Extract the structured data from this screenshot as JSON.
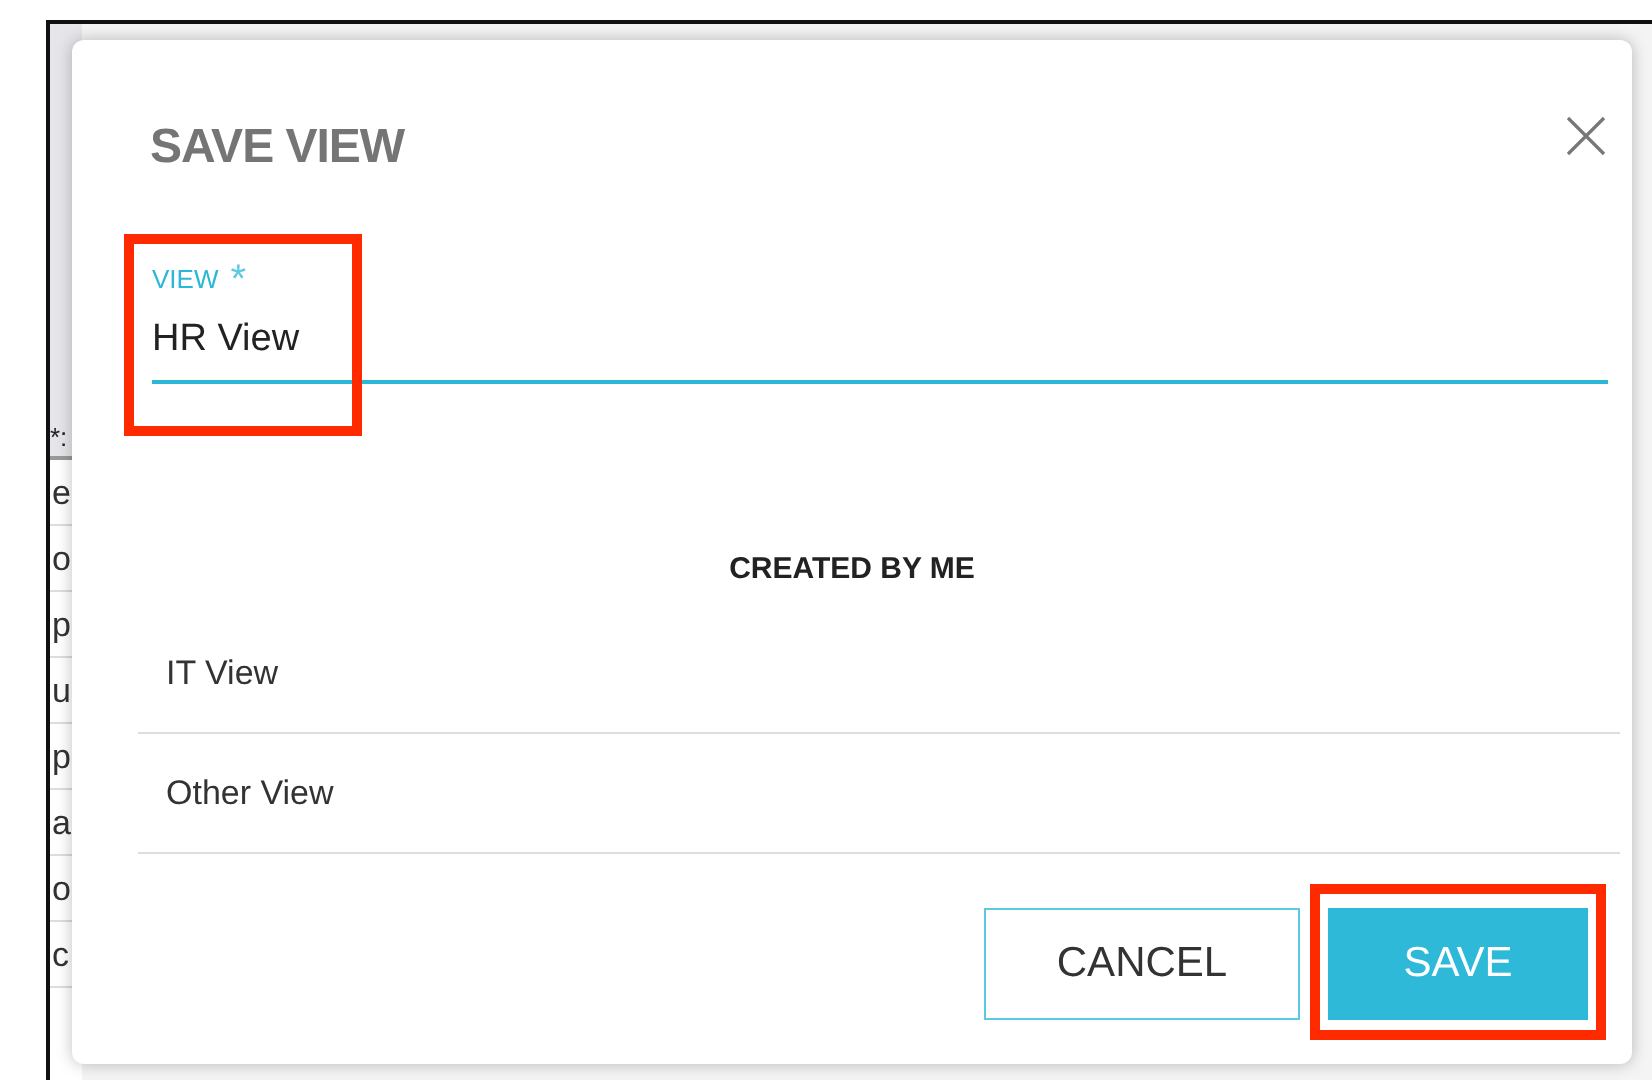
{
  "background_table": {
    "header": "*:",
    "cells": [
      "e",
      "o",
      "p",
      "u",
      "p",
      "a",
      "o",
      "c"
    ]
  },
  "dialog": {
    "title": "SAVE VIEW",
    "field": {
      "label": "VIEW",
      "required_mark": "*",
      "value": "HR View",
      "highlighted": true
    },
    "section_title": "CREATED BY ME",
    "views": [
      {
        "name": "IT View"
      },
      {
        "name": "Other View"
      }
    ],
    "buttons": [
      {
        "kind": "secondary",
        "label": "CANCEL",
        "highlighted": false
      },
      {
        "kind": "primary",
        "label": "SAVE",
        "highlighted": true
      }
    ]
  }
}
